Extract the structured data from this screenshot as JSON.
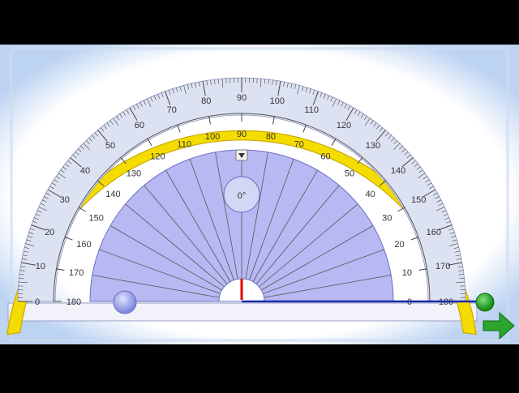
{
  "app": {
    "angle_readout": "0°"
  },
  "protractor": {
    "min_degrees": 0,
    "max_degrees": 180,
    "outer_scale_labels": [
      "0",
      "10",
      "20",
      "30",
      "40",
      "50",
      "60",
      "70",
      "80",
      "90",
      "100",
      "110",
      "120",
      "130",
      "140",
      "150",
      "160",
      "170",
      "180"
    ],
    "inner_scale_labels": [
      "180",
      "170",
      "160",
      "150",
      "140",
      "130",
      "120",
      "110",
      "100",
      "90",
      "80",
      "70",
      "60",
      "50",
      "40",
      "30",
      "20",
      "10",
      "0"
    ],
    "measured_angle_degrees": 0
  },
  "colors": {
    "background": "#000000",
    "canvas_glow": "#bcd3f2",
    "canvas": "#ffffff",
    "ring": "#f4dc00",
    "ring_edge": "#c9a800",
    "scale_band": "#dde2f3",
    "inner_fan": "#b8b9f2",
    "arm_line": "#1a2aa8",
    "zero_marker": "#e00000",
    "handle_green": "#22a022",
    "handle_blue": "#9ea6ee",
    "tick": "#333333"
  },
  "icons": {
    "drop_down": "dropdown-arrow-icon",
    "rotate_handle": "green-circle-handle",
    "next_arrow": "green-arrow-icon",
    "pivot_handle": "blue-circle-handle"
  }
}
